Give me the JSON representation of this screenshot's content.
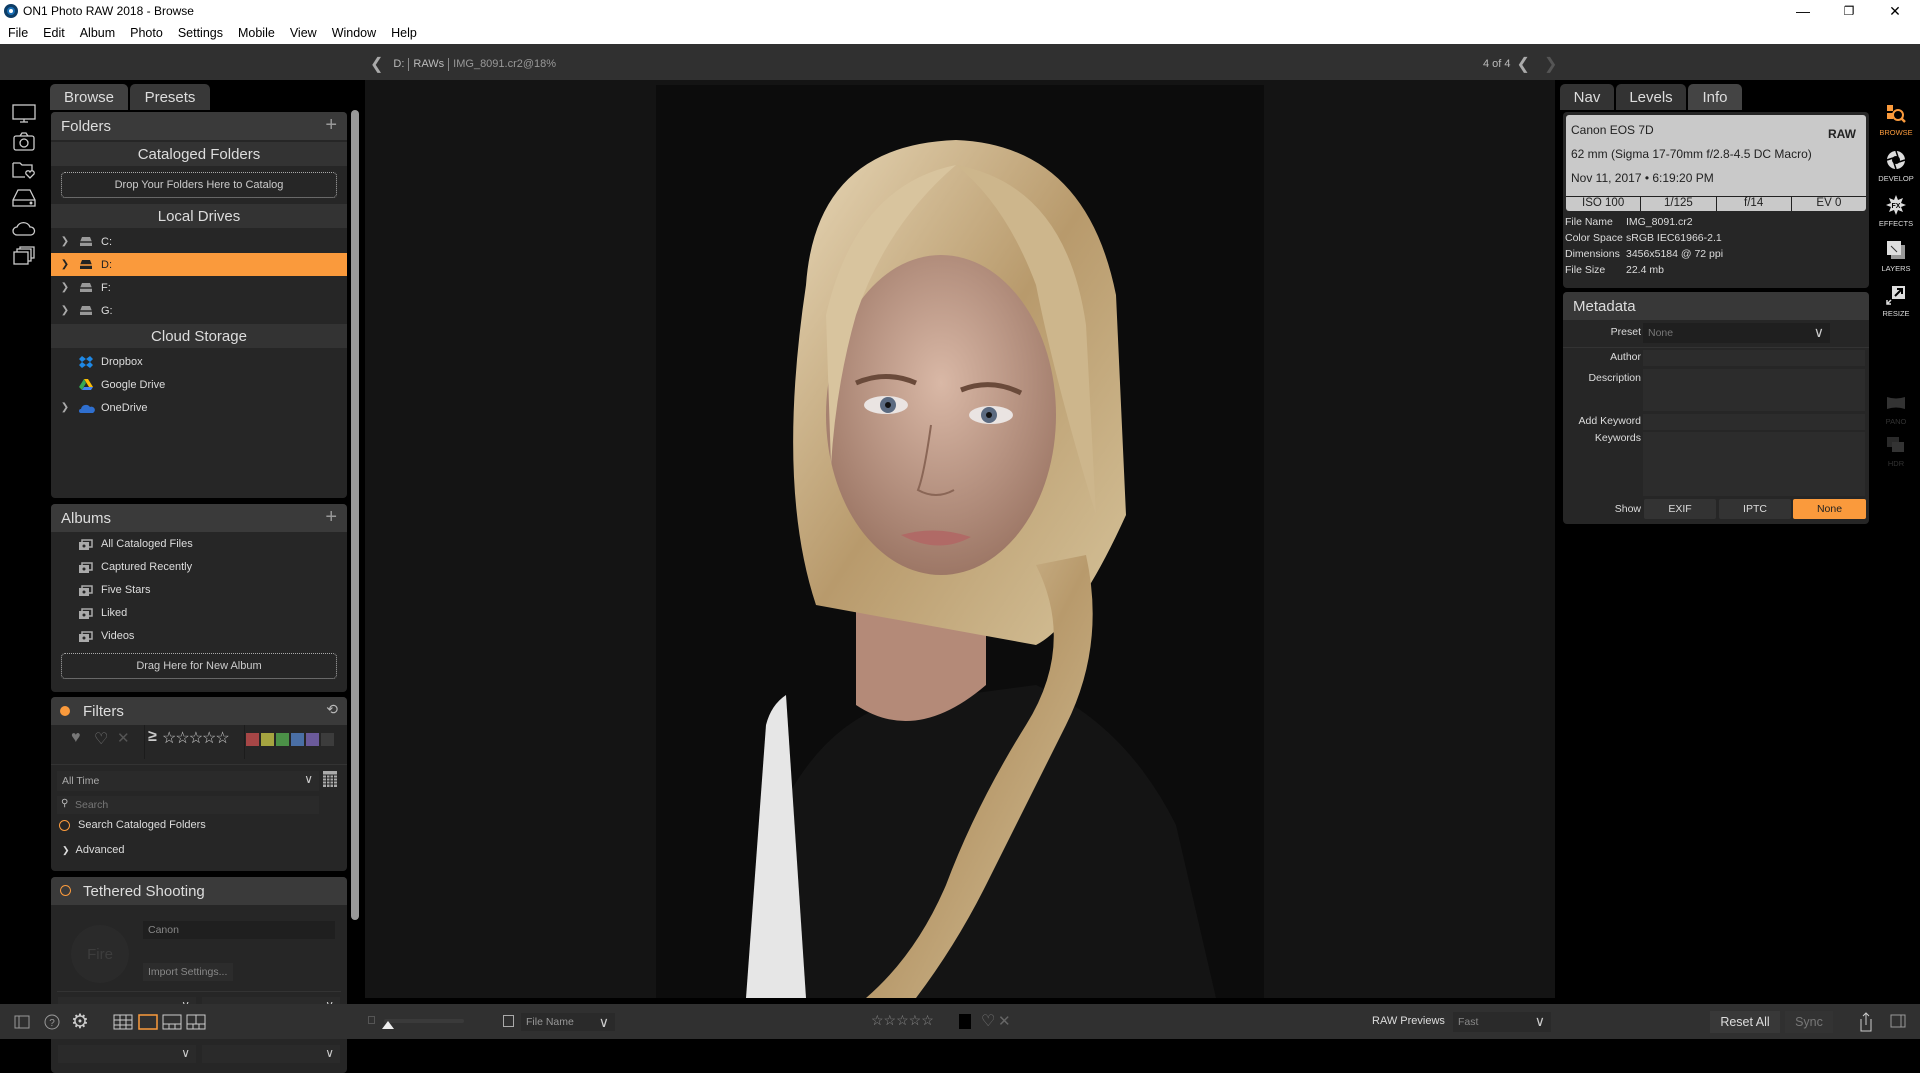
{
  "window": {
    "title": "ON1 Photo RAW 2018 - Browse",
    "minimize_icon": "minimize-icon",
    "restore_icon": "restore-icon",
    "close_icon": "close-icon"
  },
  "menu": [
    "File",
    "Edit",
    "Album",
    "Photo",
    "Settings",
    "Mobile",
    "View",
    "Window",
    "Help"
  ],
  "topbar": {
    "breadcrumb": [
      "D:",
      "RAWs",
      "IMG_8091.cr2@18%"
    ],
    "pager": "4 of 4"
  },
  "left_rail": [
    "monitor-icon",
    "camera-icon",
    "folder-heart-icon",
    "drive-icon",
    "cloud-icon",
    "albums-icon"
  ],
  "left_tabs": [
    "Browse",
    "Presets"
  ],
  "folders": {
    "title": "Folders",
    "cataloged_title": "Cataloged Folders",
    "cataloged_drop": "Drop Your Folders Here to Catalog",
    "local_title": "Local Drives",
    "drives": [
      {
        "label": "C:",
        "selected": false
      },
      {
        "label": "D:",
        "selected": true
      },
      {
        "label": "F:",
        "selected": false
      },
      {
        "label": "G:",
        "selected": false
      }
    ],
    "cloud_title": "Cloud Storage",
    "cloud": [
      {
        "label": "Dropbox",
        "icon": "dropbox-icon",
        "color": "#1e88e5"
      },
      {
        "label": "Google Drive",
        "icon": "google-drive-icon",
        "color": "#34a853"
      },
      {
        "label": "OneDrive",
        "icon": "onedrive-icon",
        "color": "#2f6fcf"
      }
    ]
  },
  "albums": {
    "title": "Albums",
    "items": [
      "All Cataloged Files",
      "Captured Recently",
      "Five Stars",
      "Liked",
      "Videos"
    ],
    "drop": "Drag Here for New Album"
  },
  "filters": {
    "title": "Filters",
    "rating_prefix": "≥",
    "stars": "☆☆☆☆☆",
    "color_labels": [
      "#a64646",
      "#a5a440",
      "#4b9047",
      "#4a6fa5",
      "#6b5a9a",
      "#3c3c3c"
    ],
    "date_value": "All Time",
    "search_placeholder": "Search",
    "search_cataloged": "Search Cataloged Folders",
    "advanced": "Advanced"
  },
  "tethered": {
    "title": "Tethered Shooting",
    "camera": "Canon",
    "fire": "Fire",
    "import_settings": "Import Settings..."
  },
  "right_tabs": [
    "Nav",
    "Levels",
    "Info"
  ],
  "info": {
    "camera": "Canon EOS 7D",
    "format": "RAW",
    "lens": "62 mm (Sigma 17-70mm f/2.8-4.5 DC Macro)",
    "datetime": "Nov 11, 2017 • 6:19:20 PM",
    "iso": "ISO 100",
    "shutter": "1/125",
    "aperture": "f/14",
    "ev": "EV 0",
    "file_name_label": "File Name",
    "file_name": "IMG_8091.cr2",
    "color_space_label": "Color Space",
    "color_space": "sRGB IEC61966-2.1",
    "dimensions_label": "Dimensions",
    "dimensions": "3456x5184 @ 72 ppi",
    "file_size_label": "File Size",
    "file_size": "22.4 mb"
  },
  "metadata": {
    "title": "Metadata",
    "preset_label": "Preset",
    "preset_value": "None",
    "author_label": "Author",
    "author_value": "",
    "description_label": "Description",
    "add_keyword_label": "Add Keyword",
    "keywords_label": "Keywords",
    "show_label": "Show",
    "show_options": [
      "EXIF",
      "IPTC",
      "None"
    ],
    "show_selected": "None"
  },
  "modules": [
    {
      "label": "BROWSE",
      "active": true
    },
    {
      "label": "DEVELOP",
      "active": false
    },
    {
      "label": "EFFECTS",
      "active": false
    },
    {
      "label": "LAYERS",
      "active": false
    },
    {
      "label": "RESIZE",
      "active": false
    },
    {
      "label": "PANO",
      "active": false,
      "disabled": true
    },
    {
      "label": "HDR",
      "active": false,
      "disabled": true
    }
  ],
  "bottombar": {
    "sort_value": "File Name",
    "rating": "☆☆☆☆☆",
    "raw_previews_label": "RAW Previews",
    "raw_previews_value": "Fast",
    "reset_all": "Reset All",
    "sync": "Sync",
    "thumbnail_size": 0.05
  },
  "colors": {
    "accent": "#fa9a3c"
  }
}
